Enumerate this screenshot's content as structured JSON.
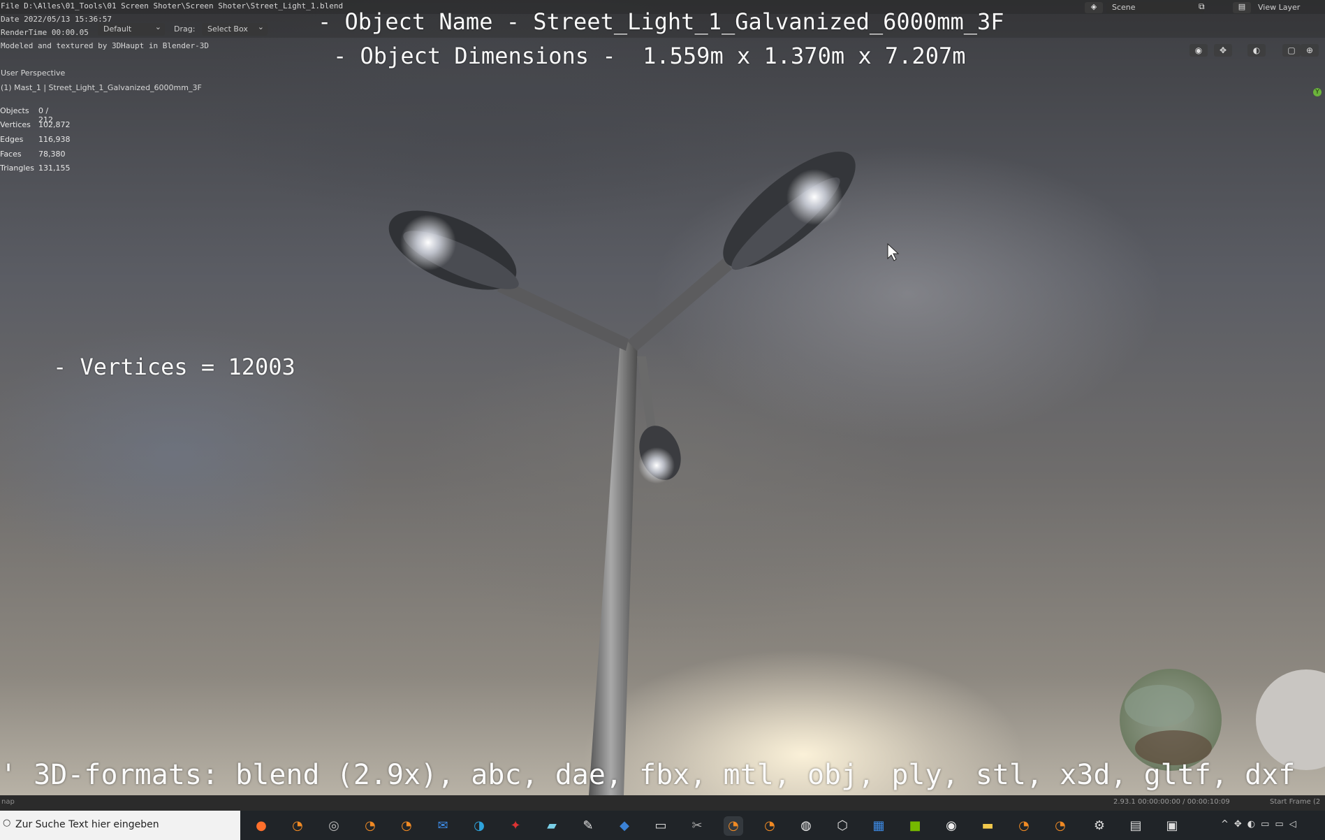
{
  "header": {
    "file_line": "File D:\\Alles\\01_Tools\\01 Screen Shoter\\Screen Shoter\\Street_Light_1.blend",
    "date_line": "Date 2022/05/13 15:36:57",
    "render_line": "RenderTime 00:00.05",
    "credit_line": "Modeled and textured by 3DHaupt in Blender-3D",
    "orientation_dd": "Default",
    "drag_label": "Drag:",
    "drag_dd": "Select Box",
    "scene": "Scene",
    "view_layer": "View Layer"
  },
  "overlay": {
    "object_name": "- Object Name - Street_Light_1_Galvanized_6000mm_3F",
    "object_dims": "- Object Dimensions -  1.559m x 1.370m x 7.207m",
    "vertices_note": "- Vertices = 12003",
    "formats": "' 3D-formats: blend (2.9x), abc, dae, fbx, mtl, obj, ply, stl, x3d, gltf, dxf"
  },
  "viewport_info": {
    "perspective": "User Perspective",
    "selection": "(1) Mast_1 | Street_Light_1_Galvanized_6000mm_3F",
    "stats": [
      {
        "label": "Objects",
        "value": "0 / 212"
      },
      {
        "label": "Vertices",
        "value": "102,872"
      },
      {
        "label": "Edges",
        "value": "116,938"
      },
      {
        "label": "Faces",
        "value": "78,380"
      },
      {
        "label": "Triangles",
        "value": "131,155"
      }
    ],
    "gizmo_axis": "Y"
  },
  "statusbar": {
    "left": "nap",
    "version": "2.93.1  00:00:00:00 / 00:00:10:09",
    "right": "Start Frame (2"
  },
  "taskbar": {
    "search_placeholder": "Zur Suche Text hier eingeben",
    "icons": [
      "firefox-icon",
      "blender-icon",
      "obs-icon",
      "blender-icon",
      "blender-icon",
      "mail-icon",
      "edge-icon",
      "app-icon",
      "notepad-icon",
      "paint-icon",
      "store-icon",
      "terminal-icon",
      "tool-icon",
      "blender-icon",
      "blender-icon",
      "panda-icon",
      "box-icon",
      "calendar-icon",
      "nvidia-icon",
      "media-icon",
      "folder-icon",
      "blender-icon",
      "blender-icon",
      "settings-icon",
      "printer-icon",
      "explorer-icon"
    ]
  }
}
